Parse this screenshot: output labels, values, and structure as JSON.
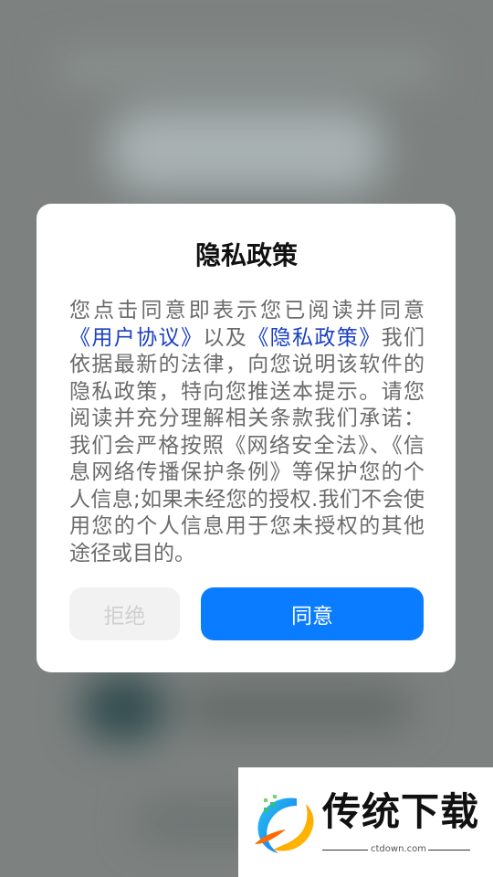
{
  "dialog": {
    "title": "隐私政策",
    "body": {
      "intro": "您点击同意即表示您已阅读并同意",
      "user_agreement_link": "《用户协议》",
      "and_text": "以及",
      "privacy_policy_link": "《隐私政策》",
      "rest": "我们依据最新的法律，向您说明该软件的隐私政策，特向您推送本提示。请您阅读并充分理解相关条款我们承诺：我们会严格按照《网络安全法》、《信息网络传播保护条例》等保护您的个人信息;如果未经您的授权.我们不会使用您的个人信息用于您未授权的其他途径或目的。"
    },
    "reject_label": "拒绝",
    "agree_label": "同意"
  },
  "watermark": {
    "brand_text": "传统下载",
    "url": "ctdown.com"
  },
  "colors": {
    "agree_button": "#0a7cff",
    "link": "#1a3fc2",
    "reject_button_bg": "#f2f2f2"
  }
}
